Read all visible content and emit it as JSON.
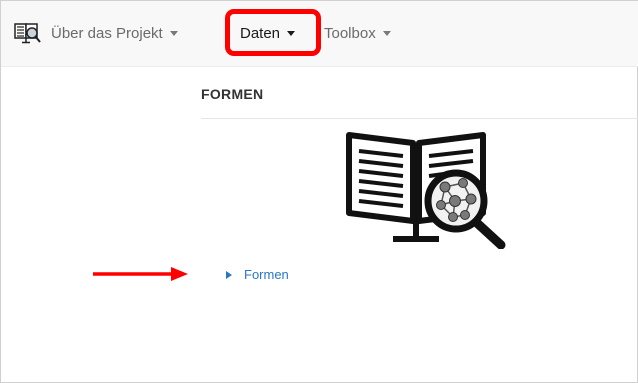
{
  "navbar": {
    "logo_icon": "book-magnifier-icon",
    "items": [
      {
        "label": "Über das Projekt"
      },
      {
        "label": "Daten"
      },
      {
        "label": "Toolbox"
      }
    ]
  },
  "main": {
    "section_title": "FORMEN",
    "illustration_icon": "book-network-magnifier-icon",
    "links": [
      {
        "label": "Formen"
      }
    ]
  },
  "annotations": {
    "highlight_color": "#ff0000",
    "arrow_color": "#ff0000"
  }
}
